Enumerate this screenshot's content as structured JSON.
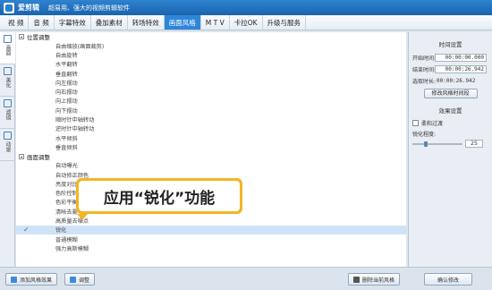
{
  "title_bar": {
    "app_name": "爱剪辑",
    "slogan": "超易用、强大的视频剪辑软件"
  },
  "menu": {
    "items": [
      {
        "label": "视 频",
        "active": false
      },
      {
        "label": "音 频",
        "active": false
      },
      {
        "label": "字幕特效",
        "active": false
      },
      {
        "label": "叠加素材",
        "active": false
      },
      {
        "label": "转场特效",
        "active": false
      },
      {
        "label": "画面风格",
        "active": true
      },
      {
        "label": "M T V",
        "active": false
      },
      {
        "label": "卡拉OK",
        "active": false
      },
      {
        "label": "升级与服务",
        "active": false
      }
    ]
  },
  "sidetabs": [
    {
      "label": "画面",
      "icon": "grid-icon",
      "active": true
    },
    {
      "label": "美化",
      "icon": "brush-icon",
      "active": false
    },
    {
      "label": "滤镜",
      "icon": "filter-icon",
      "active": false
    },
    {
      "label": "动景",
      "icon": "motion-icon",
      "active": false
    }
  ],
  "effects": {
    "groups": [
      {
        "label": "位置调整",
        "items": [
          "自由缩放(画面裁剪)",
          "自由旋转",
          "水平翻转",
          "垂直翻转",
          "向左摆动",
          "向右摆动",
          "向上摆动",
          "向下摆动",
          "顺时针中轴转动",
          "逆时针中轴转动",
          "水平倾斜",
          "垂直倾斜"
        ]
      },
      {
        "label": "画面调整",
        "items": [
          "自动曝光",
          "自动修正颜色",
          "亮度对比度",
          "色阶控制",
          "色彩平衡",
          "清晰去雾",
          "高质量去噪点",
          "锐化",
          "普通模糊",
          "强力高斯模糊"
        ]
      }
    ],
    "selected": "锐化"
  },
  "callout": {
    "text": "应用“锐化”功能"
  },
  "right_panel": {
    "time_section_title": "时间设置",
    "start_label": "开始时间:",
    "start_value": "00:00:00.000",
    "end_label": "结束时间:",
    "end_value": "00:00:26.942",
    "duration_label": "选取时长:",
    "duration_value": "00:00:26.942",
    "modify_time_button": "修改风格时间段",
    "effect_section_title": "效果设置",
    "smooth_transition_label": "柔和过渡",
    "smooth_transition_checked": false,
    "sharpen_label": "锐化程度:",
    "sharpen_value": "25",
    "sharpen_level": 0.25
  },
  "bottom_bar": {
    "add_effect_button": "添加风格效果",
    "adjust_button": "调整",
    "delete_effect_button": "删除当前风格",
    "confirm_button": "确认修改"
  },
  "colors": {
    "accent": "#2f86d8",
    "callout": "#f3b525"
  }
}
